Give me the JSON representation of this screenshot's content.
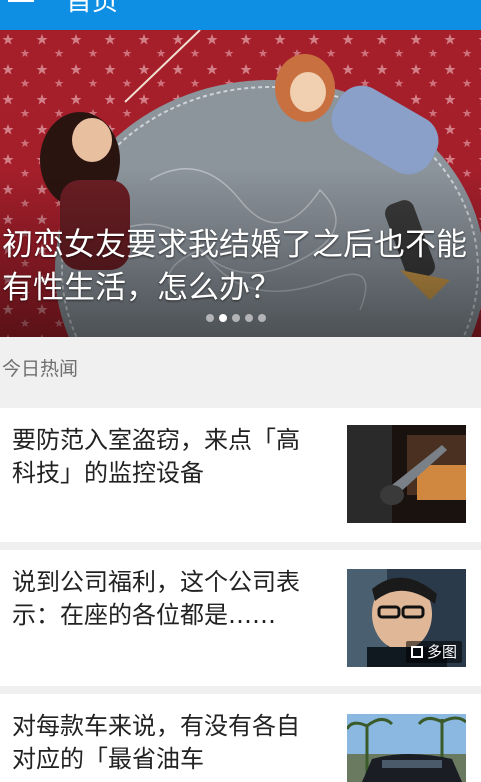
{
  "appbar": {
    "title": "首页",
    "menu_icon": "menu-icon",
    "bell_icon": "bell-icon",
    "more_icon": "more-vertical-icon",
    "color": "#0e8fe4"
  },
  "banner": {
    "headline": "初恋女友要求我结婚了之后也不能有性生活，怎么办？",
    "dots_total": 5,
    "dots_active_index": 1
  },
  "section": {
    "title": "今日热闻"
  },
  "stories": [
    {
      "title": "要防范入室盗窃，来点「高科技」的监控设备"
    },
    {
      "title": "说到公司福利，这个公司表示：在座的各位都是……",
      "badge": "多图"
    },
    {
      "title": "对每款车来说，有没有各自对应的「最省油车"
    }
  ]
}
